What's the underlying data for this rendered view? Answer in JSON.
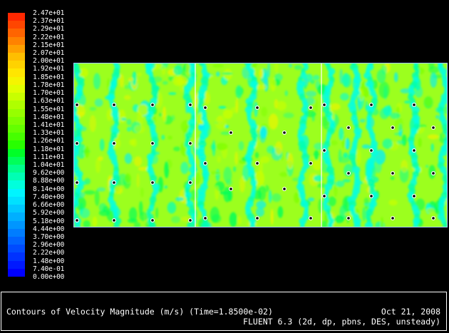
{
  "colormap": {
    "labels": [
      "2.47e+01",
      "2.37e+01",
      "2.29e+01",
      "2.22e+01",
      "2.15e+01",
      "2.07e+01",
      "2.00e+01",
      "1.92e+01",
      "1.85e+01",
      "1.78e+01",
      "1.70e+01",
      "1.63e+01",
      "1.55e+01",
      "1.48e+01",
      "1.41e+01",
      "1.33e+01",
      "1.26e+01",
      "1.18e+01",
      "1.11e+01",
      "1.04e+01",
      "9.62e+00",
      "8.88e+00",
      "8.14e+00",
      "7.40e+00",
      "6.66e+00",
      "5.92e+00",
      "5.18e+00",
      "4.44e+00",
      "3.70e+00",
      "2.96e+00",
      "2.22e+00",
      "1.48e+00",
      "7.40e-01",
      "0.00e+00"
    ],
    "colors": [
      "#ff2800",
      "#ff4600",
      "#ff6400",
      "#ff8200",
      "#ffa000",
      "#ffbe00",
      "#ffd200",
      "#ffe600",
      "#f5f500",
      "#e1ff00",
      "#c8ff00",
      "#afff00",
      "#96ff00",
      "#7dff00",
      "#64ff00",
      "#46ff00",
      "#28ff00",
      "#00ff28",
      "#00ff5a",
      "#00ff8c",
      "#00ffb4",
      "#00ffdc",
      "#00f5ff",
      "#00e1ff",
      "#00c8ff",
      "#00afff",
      "#0096ff",
      "#007dff",
      "#0064ff",
      "#004bff",
      "#0032ff",
      "#0019ff",
      "#0000ff"
    ]
  },
  "caption": {
    "title": "Contours of Velocity Magnitude (m/s)  (Time=1.8500e-02)",
    "date": "Oct 21, 2008",
    "solver": "FLUENT 6.3 (2d, dp, pbns, DES, unsteady)"
  }
}
